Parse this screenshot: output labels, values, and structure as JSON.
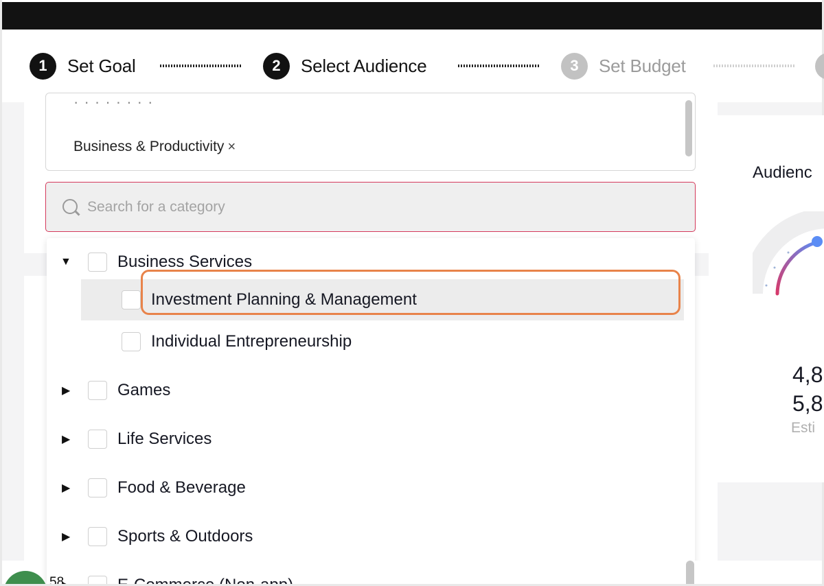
{
  "stepper": {
    "steps": [
      {
        "num": "1",
        "label": "Set Goal",
        "state": "complete"
      },
      {
        "num": "2",
        "label": "Select Audience",
        "state": "active"
      },
      {
        "num": "3",
        "label": "Set Budget",
        "state": "inactive"
      }
    ]
  },
  "selected": {
    "tags": [
      {
        "label": "Business & Productivity",
        "remove": "×"
      }
    ]
  },
  "search": {
    "placeholder": "Search for a category",
    "value": ""
  },
  "categories": [
    {
      "label": "Business Services",
      "expanded": true,
      "checked": false
    },
    {
      "label": "Investment Planning & Management",
      "child": true,
      "checked": false,
      "hovered": true
    },
    {
      "label": "Individual Entrepreneurship",
      "child": true,
      "checked": false
    },
    {
      "label": "Games",
      "expanded": false,
      "checked": false
    },
    {
      "label": "Life Services",
      "expanded": false,
      "checked": false
    },
    {
      "label": "Food & Beverage",
      "expanded": false,
      "checked": false
    },
    {
      "label": "Sports & Outdoors",
      "expanded": false,
      "checked": false
    },
    {
      "label": "E-Commerce (Non-app)",
      "expanded": false,
      "checked": false
    }
  ],
  "audience_panel": {
    "title": "Audienc",
    "value_a": "4,8",
    "value_b": "5,8",
    "caption": "Esti"
  },
  "bottom": {
    "number": "58"
  },
  "colors": {
    "accent_border": "#d4385a",
    "highlight_ring": "#e8834a",
    "gauge_start": "#d63a6b",
    "gauge_end": "#5b8df5"
  }
}
